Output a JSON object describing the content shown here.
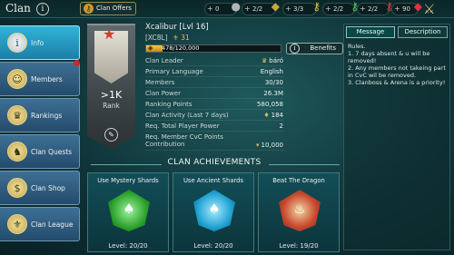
{
  "topbar": {
    "title": "Clan",
    "offers_label": "Clan Offers",
    "resources": [
      {
        "plus": "+",
        "value": "0",
        "icon": "silver-coin-icon",
        "glyph": "●",
        "color": "#b0b4b8"
      },
      {
        "plus": "+",
        "value": "2/2",
        "icon": "arena-token-icon",
        "glyph": "◆",
        "color": "#c9a740"
      },
      {
        "plus": "+",
        "value": "3/3",
        "icon": "key-icon",
        "glyph": "⚷",
        "color": "#e0c34a"
      },
      {
        "plus": "+",
        "value": "2/2",
        "icon": "green-key-icon",
        "glyph": "⚷",
        "color": "#4fd15a"
      },
      {
        "plus": "+",
        "value": "2/2",
        "icon": "red-key-icon",
        "glyph": "⚷",
        "color": "#e24040"
      },
      {
        "plus": "+",
        "value": "90",
        "icon": "gem-icon",
        "glyph": "◆",
        "color": "#e03245"
      }
    ]
  },
  "nav": {
    "items": [
      {
        "label": "Info",
        "icon": "info-icon",
        "glyph": "i"
      },
      {
        "label": "Members",
        "icon": "members-icon",
        "glyph": "☺"
      },
      {
        "label": "Rankings",
        "icon": "trophy-icon",
        "glyph": "♛"
      },
      {
        "label": "Clan Quests",
        "icon": "quests-icon",
        "glyph": "♞"
      },
      {
        "label": "Clan Shop",
        "icon": "shop-icon",
        "glyph": "$"
      },
      {
        "label": "Clan League",
        "icon": "league-icon",
        "glyph": "⚜"
      }
    ]
  },
  "banner": {
    "rank_value": ">1K",
    "rank_label": "Rank"
  },
  "clan": {
    "name": "Xcalibur [Lvl 16]",
    "tag": "[XC8L]",
    "tag_value": "31",
    "xp_text": "478/120,000",
    "xp_fraction": 0.004,
    "benefits_label": "Benefits",
    "stats": [
      {
        "label": "Clan Leader",
        "value": "báró",
        "icon": "crown-icon",
        "glyph": "♛"
      },
      {
        "label": "Primary Language",
        "value": "English",
        "icon": "",
        "glyph": ""
      },
      {
        "label": "Members",
        "value": "30/30",
        "icon": "",
        "glyph": ""
      },
      {
        "label": "Clan Power",
        "value": "26.3M",
        "icon": "",
        "glyph": ""
      },
      {
        "label": "Ranking Points",
        "value": "580,058",
        "icon": "",
        "glyph": ""
      },
      {
        "label": "Clan Activity (Last 7 days)",
        "value": "184",
        "icon": "activity-icon",
        "glyph": "♦"
      },
      {
        "label": "Req. Total Player Power",
        "value": "2",
        "icon": "",
        "glyph": ""
      },
      {
        "label": "Req. Member CvC Points Contribution",
        "value": "10,000",
        "icon": "cvc-icon",
        "glyph": "▾"
      }
    ]
  },
  "messages": {
    "tab_message": "Message",
    "tab_description": "Description",
    "rules_text": "Rules.\n1. 7 days absent & u will be removed!\n2. Any members not takeing part in CvC wil be removed.\n3. Clanboss & Arena is a priority!"
  },
  "achievements": {
    "header": "CLAN ACHIEVEMENTS",
    "cards": [
      {
        "title": "Use Mystery Shards",
        "level": "Level: 20/20",
        "color": "#3fcf3f",
        "icon": "mystery-shard-badge-icon",
        "glyph": "♠"
      },
      {
        "title": "Use Ancient Shards",
        "level": "Level: 20/20",
        "color": "#2fc0e6",
        "icon": "ancient-shard-badge-icon",
        "glyph": "♠"
      },
      {
        "title": "Beat The Dragon",
        "level": "Level: 19/20",
        "color": "#d23a2e",
        "icon": "dragon-badge-icon",
        "glyph": "♨"
      }
    ]
  }
}
